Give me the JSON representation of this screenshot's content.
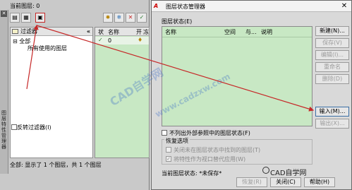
{
  "palette": {
    "current_layer": "当前图层: 0",
    "side_label": "图层特性管理器",
    "filters_header": "过滤器",
    "collapse": "«",
    "tree": {
      "root": "全部",
      "child": "所有使用的图层"
    },
    "columns": {
      "status": "状",
      "name": "名称",
      "on": "开",
      "freeze": "冻"
    },
    "row": {
      "name": "0"
    },
    "invert_filter": "反转过滤器(I)",
    "status": "全部: 显示了 1 个图层，共 1 个图层",
    "toolbar_icons": [
      "new-filter-icon",
      "group-filter-icon",
      "layer-states-icon",
      "new-layer-icon",
      "new-layer-frozen-icon",
      "delete-layer-icon",
      "set-current-icon"
    ]
  },
  "dialog": {
    "title": "图层状态管理器",
    "app_icon": "A",
    "close": "✕",
    "states_label": "图层状态(E)",
    "columns": {
      "name": "名称",
      "space": "空间",
      "same": "与...",
      "desc": "说明"
    },
    "buttons": {
      "new": "新建(N)...",
      "save": "保存(V)",
      "edit": "编辑(I)...",
      "rename": "重命名",
      "delete": "删除(D)",
      "import": "输入(M)...",
      "export": "输出(X)..."
    },
    "no_xref": "不列出外部参照中的图层状态(F)",
    "restore_options_title": "恢复选项",
    "restore_options": {
      "turn_off": "关闭未在图层状态中找到的图层(T)",
      "viewport": "将特性作为视口替代应用(W)"
    },
    "current_state": "当前图层状态:  *未保存*",
    "bottom": {
      "restore": "恢复(R)",
      "close": "关闭(C)",
      "help": "帮助(H)"
    }
  },
  "watermark": {
    "cad": "CAD自学网",
    "url": "www.cadzxw.com",
    "brand": "CAD自学网"
  },
  "colors": {
    "grid_green": "#c8e8c4",
    "arrow_red": "#c62828",
    "dialog_gray": "#d9d9d9"
  }
}
